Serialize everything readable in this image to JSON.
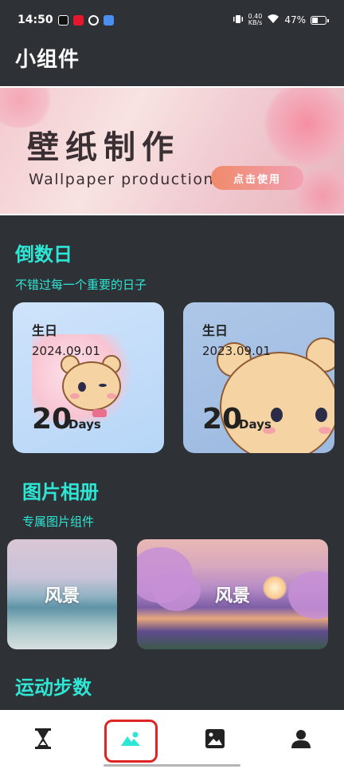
{
  "status_bar": {
    "time": "14:50",
    "speed_value": "0.40",
    "speed_unit": "KB/s",
    "battery_text": "47%",
    "battery_level": 0.47
  },
  "header": {
    "title": "小组件"
  },
  "banner": {
    "title": "壁纸制作",
    "subtitle": "Wallpaper production",
    "button_label": "点击使用"
  },
  "countdown": {
    "title": "倒数日",
    "subtitle": "不错过每一个重要的日子",
    "cards": [
      {
        "label": "生日",
        "date": "2024.09.01",
        "days": "20",
        "unit": "Days"
      },
      {
        "label": "生日",
        "date": "2023.09.01",
        "days": "20",
        "unit": "Days"
      }
    ]
  },
  "album": {
    "title": "图片相册",
    "subtitle": "专属图片组件",
    "tiles": [
      {
        "label": "风景"
      },
      {
        "label": "风景"
      }
    ]
  },
  "steps": {
    "title": "运动步数"
  },
  "nav": {
    "items": [
      {
        "icon": "hourglass-icon"
      },
      {
        "icon": "mountain-widget-icon",
        "selected": true
      },
      {
        "icon": "image-icon"
      },
      {
        "icon": "person-icon"
      }
    ],
    "active_color": "#2ee6d4",
    "highlight_color": "#e02424"
  },
  "colors": {
    "background": "#2e3136",
    "accent": "#2ee6d4"
  }
}
